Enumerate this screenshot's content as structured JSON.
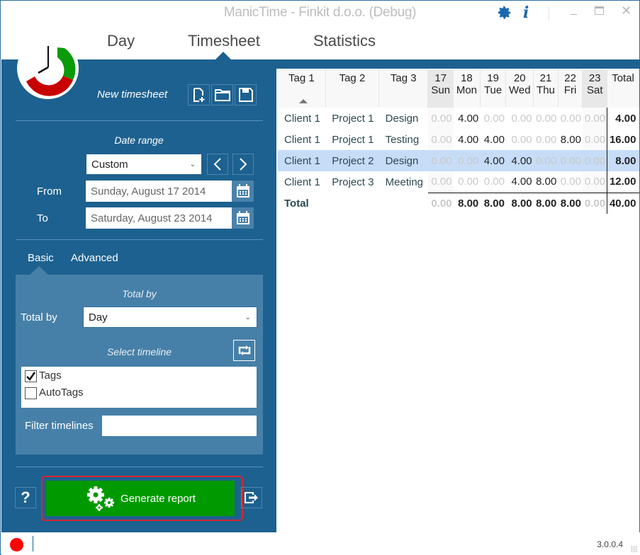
{
  "window": {
    "title": "ManicTime - Finkit d.o.o. (Debug)",
    "icons": [
      "gear-icon",
      "info-icon"
    ],
    "controls": [
      "minimize",
      "maximize",
      "close"
    ]
  },
  "nav": {
    "tabs": [
      {
        "label": "Day",
        "active": false
      },
      {
        "label": "Timesheet",
        "active": true
      },
      {
        "label": "Statistics",
        "active": false
      }
    ]
  },
  "sidebar": {
    "timesheet_name": "New timesheet",
    "file_buttons": [
      "new-file",
      "open-folder",
      "save"
    ],
    "date_range": {
      "heading": "Date range",
      "preset": "Custom",
      "from_label": "From",
      "from_value": "Sunday, August 17 2014",
      "to_label": "To",
      "to_value": "Saturday, August 23 2014"
    },
    "tabs": [
      {
        "label": "Basic",
        "active": true
      },
      {
        "label": "Advanced",
        "active": false
      }
    ],
    "total_by": {
      "heading": "Total by",
      "label": "Total by",
      "value": "Day"
    },
    "timeline": {
      "heading": "Select timeline",
      "items": [
        {
          "label": "Tags",
          "checked": true
        },
        {
          "label": "AutoTags",
          "checked": false
        }
      ],
      "filter_label": "Filter timelines",
      "filter_value": ""
    },
    "help_label": "?",
    "generate_label": "Generate report"
  },
  "grid": {
    "columns": [
      {
        "top": "Tag 1",
        "bottom": ""
      },
      {
        "top": "Tag 2",
        "bottom": ""
      },
      {
        "top": "Tag 3",
        "bottom": ""
      },
      {
        "top": "17",
        "bottom": "Sun"
      },
      {
        "top": "18",
        "bottom": "Mon"
      },
      {
        "top": "19",
        "bottom": "Tue"
      },
      {
        "top": "20",
        "bottom": "Wed"
      },
      {
        "top": "21",
        "bottom": "Thu"
      },
      {
        "top": "22",
        "bottom": "Fri"
      },
      {
        "top": "23",
        "bottom": "Sat"
      },
      {
        "top": "Total",
        "bottom": ""
      }
    ],
    "sort_column": "Tag 1",
    "rows": [
      {
        "tags": [
          "Client 1",
          "Project 1",
          "Design"
        ],
        "days": [
          "0.00",
          "4.00",
          "0.00",
          "0.00",
          "0.00",
          "0.00",
          "0.00"
        ],
        "total": "4.00",
        "selected": false
      },
      {
        "tags": [
          "Client 1",
          "Project 1",
          "Testing"
        ],
        "days": [
          "0.00",
          "4.00",
          "4.00",
          "0.00",
          "0.00",
          "8.00",
          "0.00"
        ],
        "total": "16.00",
        "selected": false
      },
      {
        "tags": [
          "Client 1",
          "Project 2",
          "Design"
        ],
        "days": [
          "0.00",
          "0.00",
          "4.00",
          "4.00",
          "0.00",
          "0.00",
          "0.00"
        ],
        "total": "8.00",
        "selected": true
      },
      {
        "tags": [
          "Client 1",
          "Project 3",
          "Meeting"
        ],
        "days": [
          "0.00",
          "0.00",
          "0.00",
          "4.00",
          "8.00",
          "0.00",
          "0.00"
        ],
        "total": "12.00",
        "selected": false
      }
    ],
    "total_row": {
      "label": "Total",
      "days": [
        "0.00",
        "8.00",
        "8.00",
        "8.00",
        "8.00",
        "8.00",
        "0.00"
      ],
      "total": "40.00"
    }
  },
  "status": {
    "recording_color": "#ff0000",
    "version": "3.0.0.4"
  },
  "colors": {
    "sidebar": "#1d6190",
    "panel": "#4680a8",
    "generate": "#009900",
    "accent_icon": "#1c67b0",
    "selection": "#c7dcf7"
  }
}
